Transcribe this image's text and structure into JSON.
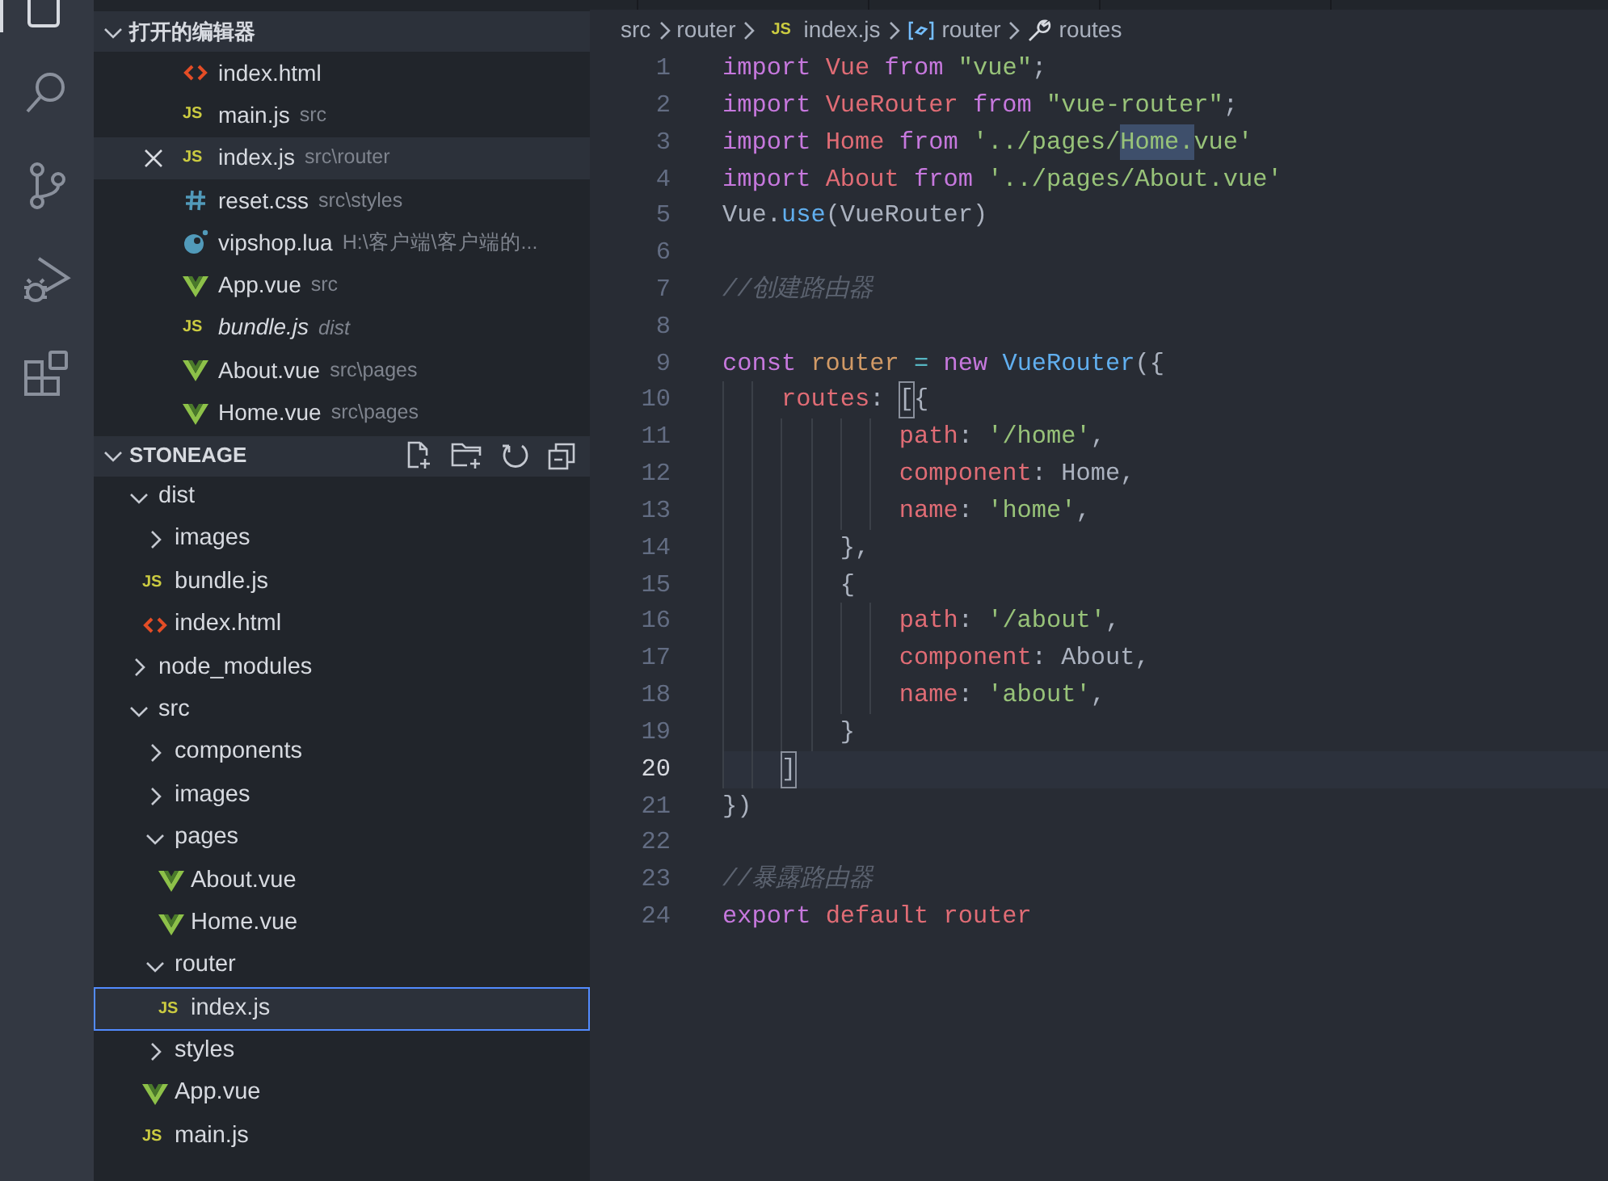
{
  "open_editors": {
    "title": "打开的编辑器",
    "expanded": true,
    "items": [
      {
        "name": "index.html",
        "kind": "html-file",
        "italic": false,
        "selected": false
      },
      {
        "name": "main.js",
        "path": "src",
        "kind": "js-file",
        "badge": "JS",
        "italic": false,
        "selected": false
      },
      {
        "name": "index.js",
        "path": "src\\router",
        "kind": "js-file",
        "badge": "JS",
        "italic": false,
        "selected": true
      },
      {
        "name": "reset.css",
        "path": "src\\styles",
        "kind": "css-file",
        "italic": false,
        "selected": false
      },
      {
        "name": "vipshop.lua",
        "path": "H:\\客户端\\客户端的...",
        "kind": "lua-file",
        "italic": false,
        "selected": false
      },
      {
        "name": "App.vue",
        "path": "src",
        "kind": "vue-file",
        "italic": false,
        "selected": false
      },
      {
        "name": "bundle.js",
        "path": "dist",
        "kind": "js-file",
        "badge": "JS",
        "italic": true,
        "selected": false
      },
      {
        "name": "About.vue",
        "path": "src\\pages",
        "kind": "vue-file",
        "italic": false,
        "selected": false
      },
      {
        "name": "Home.vue",
        "path": "src\\pages",
        "kind": "vue-file",
        "italic": false,
        "selected": false
      }
    ]
  },
  "explorer": {
    "title": "STONEAGE",
    "expanded": true,
    "tree": [
      {
        "name": "dist",
        "kind": "folder",
        "expanded": true,
        "selected": false,
        "children": [
          {
            "name": "images",
            "kind": "folder",
            "expanded": false,
            "selected": false
          },
          {
            "name": "bundle.js",
            "kind": "js-file",
            "badge": "JS",
            "selected": false
          },
          {
            "name": "index.html",
            "kind": "html-file",
            "selected": false
          }
        ]
      },
      {
        "name": "node_modules",
        "kind": "folder",
        "expanded": false,
        "selected": false
      },
      {
        "name": "src",
        "kind": "folder",
        "expanded": true,
        "selected": false,
        "children": [
          {
            "name": "components",
            "kind": "folder",
            "expanded": false,
            "selected": false
          },
          {
            "name": "images",
            "kind": "folder",
            "expanded": false,
            "selected": false
          },
          {
            "name": "pages",
            "kind": "folder",
            "expanded": true,
            "selected": false,
            "children": [
              {
                "name": "About.vue",
                "kind": "vue-file",
                "selected": false
              },
              {
                "name": "Home.vue",
                "kind": "vue-file",
                "selected": false
              }
            ]
          },
          {
            "name": "router",
            "kind": "folder",
            "expanded": true,
            "selected": false,
            "children": [
              {
                "name": "index.js",
                "kind": "js-file",
                "badge": "JS",
                "selected": true
              }
            ]
          },
          {
            "name": "styles",
            "kind": "folder",
            "expanded": false,
            "selected": false
          },
          {
            "name": "App.vue",
            "kind": "vue-file",
            "selected": false
          },
          {
            "name": "main.js",
            "kind": "js-file",
            "badge": "JS",
            "selected": false
          }
        ]
      }
    ]
  },
  "breadcrumbs": [
    {
      "label": "src",
      "kind": "folder"
    },
    {
      "label": "router",
      "kind": "folder"
    },
    {
      "label": "index.js",
      "kind": "js-file",
      "badge": "JS"
    },
    {
      "label": "router",
      "kind": "variable"
    },
    {
      "label": "routes",
      "kind": "property"
    }
  ],
  "editor": {
    "lines": [
      {
        "number": "1",
        "current": false,
        "tokens": [
          {
            "text": "import ",
            "kind": "keyword"
          },
          {
            "text": "Vue ",
            "kind": "variable"
          },
          {
            "text": "from ",
            "kind": "keyword"
          },
          {
            "text": "\"vue\"",
            "kind": "string"
          },
          {
            "text": ";",
            "kind": "plain"
          }
        ]
      },
      {
        "number": "2",
        "current": false,
        "tokens": [
          {
            "text": "import ",
            "kind": "keyword"
          },
          {
            "text": "VueRouter ",
            "kind": "variable"
          },
          {
            "text": "from ",
            "kind": "keyword"
          },
          {
            "text": "\"vue-router\"",
            "kind": "string"
          },
          {
            "text": ";",
            "kind": "plain"
          }
        ]
      },
      {
        "number": "3",
        "current": false,
        "tokens": [
          {
            "text": "import ",
            "kind": "keyword"
          },
          {
            "text": "Home ",
            "kind": "variable"
          },
          {
            "text": "from ",
            "kind": "keyword"
          },
          {
            "text": "'../pages/",
            "kind": "string"
          },
          {
            "text": "Home.",
            "kind": "selected"
          },
          {
            "text": "vue'",
            "kind": "string"
          }
        ]
      },
      {
        "number": "4",
        "current": false,
        "tokens": [
          {
            "text": "import ",
            "kind": "keyword"
          },
          {
            "text": "About ",
            "kind": "variable"
          },
          {
            "text": "from ",
            "kind": "keyword"
          },
          {
            "text": "'../pages/About.vue'",
            "kind": "string"
          }
        ]
      },
      {
        "number": "5",
        "current": false,
        "tokens": [
          {
            "text": "Vue.",
            "kind": "plain"
          },
          {
            "text": "use",
            "kind": "method"
          },
          {
            "text": "(VueRouter)",
            "kind": "plain"
          }
        ]
      },
      {
        "number": "6",
        "current": false
      },
      {
        "number": "7",
        "current": false,
        "tokens": [
          {
            "text": "//创建路由器",
            "kind": "comment"
          }
        ]
      },
      {
        "number": "8",
        "current": false
      },
      {
        "number": "9",
        "current": false,
        "tokens": [
          {
            "text": "const ",
            "kind": "keyword"
          },
          {
            "text": "router ",
            "kind": "constant"
          },
          {
            "text": "= ",
            "kind": "operator"
          },
          {
            "text": "new ",
            "kind": "keyword"
          },
          {
            "text": "VueRouter",
            "kind": "method"
          },
          {
            "text": "({",
            "kind": "plain"
          }
        ]
      },
      {
        "number": "10",
        "current": false,
        "tokens": [
          {
            "text": "    routes",
            "kind": "variable"
          },
          {
            "text": ": ",
            "kind": "plain"
          },
          {
            "text": "[",
            "kind": "bracket"
          },
          {
            "text": "{",
            "kind": "plain"
          }
        ]
      },
      {
        "number": "11",
        "current": false,
        "tokens": [
          {
            "text": "            path",
            "kind": "variable"
          },
          {
            "text": ": ",
            "kind": "plain"
          },
          {
            "text": "'/home'",
            "kind": "string"
          },
          {
            "text": ",",
            "kind": "plain"
          }
        ]
      },
      {
        "number": "12",
        "current": false,
        "tokens": [
          {
            "text": "            component",
            "kind": "variable"
          },
          {
            "text": ": Home,",
            "kind": "plain"
          }
        ]
      },
      {
        "number": "13",
        "current": false,
        "tokens": [
          {
            "text": "            name",
            "kind": "variable"
          },
          {
            "text": ": ",
            "kind": "plain"
          },
          {
            "text": "'home'",
            "kind": "string"
          },
          {
            "text": ",",
            "kind": "plain"
          }
        ]
      },
      {
        "number": "14",
        "current": false,
        "tokens": [
          {
            "text": "        },",
            "kind": "plain"
          }
        ]
      },
      {
        "number": "15",
        "current": false,
        "tokens": [
          {
            "text": "        {",
            "kind": "plain"
          }
        ]
      },
      {
        "number": "16",
        "current": false,
        "tokens": [
          {
            "text": "            path",
            "kind": "variable"
          },
          {
            "text": ": ",
            "kind": "plain"
          },
          {
            "text": "'/about'",
            "kind": "string"
          },
          {
            "text": ",",
            "kind": "plain"
          }
        ]
      },
      {
        "number": "17",
        "current": false,
        "tokens": [
          {
            "text": "            component",
            "kind": "variable"
          },
          {
            "text": ": About,",
            "kind": "plain"
          }
        ]
      },
      {
        "number": "18",
        "current": false,
        "tokens": [
          {
            "text": "            name",
            "kind": "variable"
          },
          {
            "text": ": ",
            "kind": "plain"
          },
          {
            "text": "'about'",
            "kind": "string"
          },
          {
            "text": ",",
            "kind": "plain"
          }
        ]
      },
      {
        "number": "19",
        "current": false,
        "tokens": [
          {
            "text": "        }",
            "kind": "plain"
          }
        ]
      },
      {
        "number": "20",
        "current": true,
        "tokens": [
          {
            "text": "    ]",
            "kind": "bracket"
          }
        ]
      },
      {
        "number": "21",
        "current": false,
        "tokens": [
          {
            "text": "})",
            "kind": "plain"
          }
        ]
      },
      {
        "number": "22",
        "current": false
      },
      {
        "number": "23",
        "current": false,
        "tokens": [
          {
            "text": "//暴露路由器",
            "kind": "comment"
          }
        ]
      },
      {
        "number": "24",
        "current": false,
        "tokens": [
          {
            "text": "export ",
            "kind": "keyword"
          },
          {
            "text": "default router",
            "kind": "variable"
          }
        ]
      }
    ]
  }
}
